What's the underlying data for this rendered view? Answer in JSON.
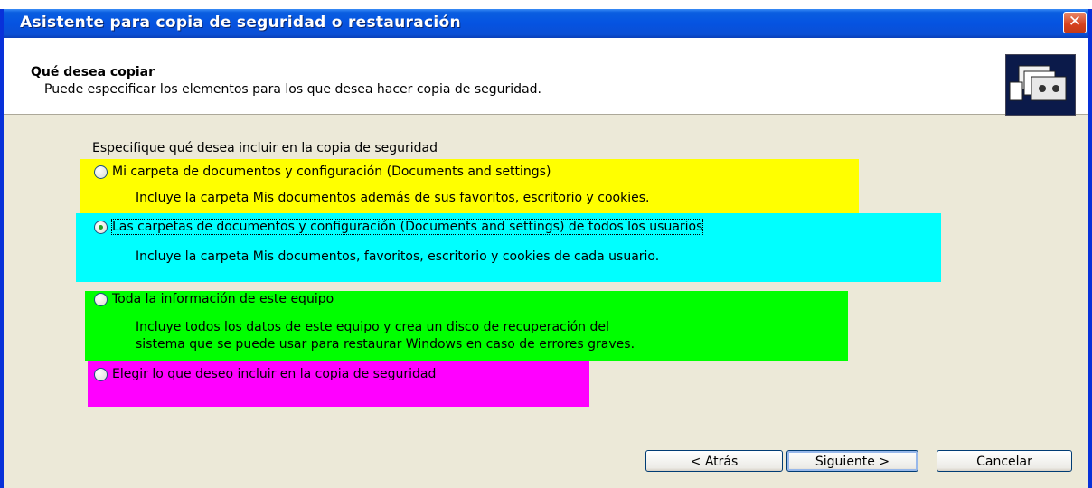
{
  "window": {
    "title": "Asistente para copia de seguridad o restauración",
    "close_symbol": "✕",
    "titlebar_color": "#0553e1"
  },
  "header": {
    "title": "Qué desea copiar",
    "subtitle": "Puede especificar los elementos para los que desea hacer copia de seguridad.",
    "icon": "backup-wizard-icon"
  },
  "instruction": "Especifique qué desea incluir en la copia de seguridad",
  "options": [
    {
      "label": "Mi carpeta de documentos y configuración (Documents and settings)",
      "description": "Incluye la carpeta Mis documentos además de sus favoritos, escritorio y cookies.",
      "selected": false,
      "highlight": "#ffff00"
    },
    {
      "label": "Las carpetas de documentos y configuración (Documents and settings) de todos los usuarios",
      "description": "Incluye la carpeta Mis documentos, favoritos, escritorio y cookies de cada usuario.",
      "selected": true,
      "highlight": "#00ffff"
    },
    {
      "label": "Toda la información de este equipo",
      "description_line1": "Incluye todos los datos de este equipo y crea un disco de recuperación del",
      "description_line2": "sistema que se puede usar para restaurar Windows en caso de errores graves.",
      "selected": false,
      "highlight": "#00ff00"
    },
    {
      "label": "Elegir lo que deseo incluir en la copia de seguridad",
      "selected": false,
      "highlight": "#ff00ff"
    }
  ],
  "buttons": {
    "back": "< Atrás",
    "next": "Siguiente >",
    "cancel": "Cancelar"
  }
}
